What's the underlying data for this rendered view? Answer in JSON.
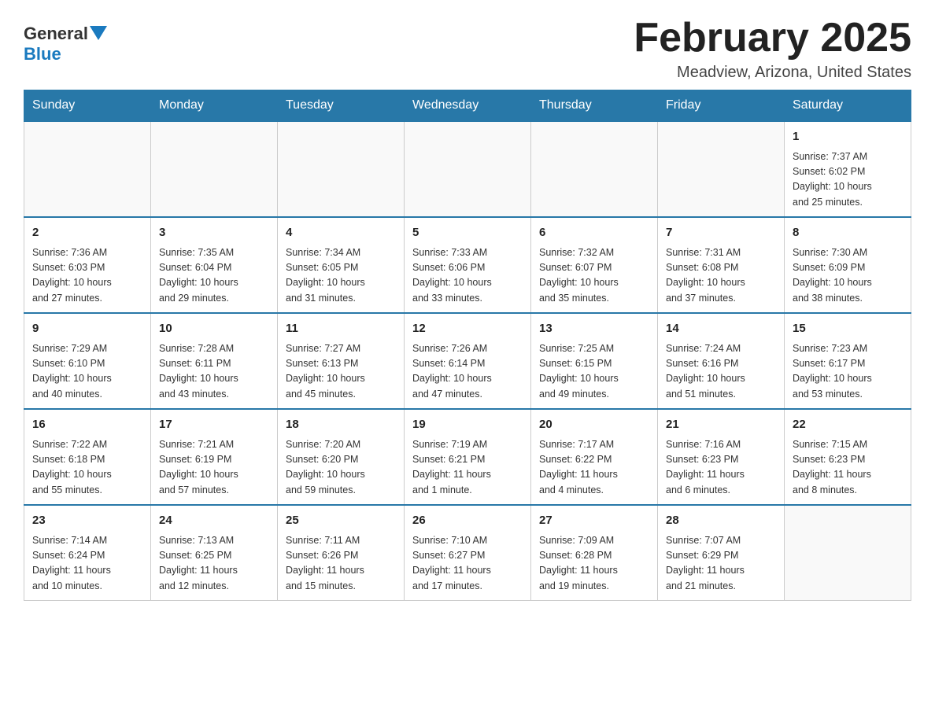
{
  "logo": {
    "general": "General",
    "blue": "Blue",
    "triangle": "▲"
  },
  "header": {
    "title": "February 2025",
    "location": "Meadview, Arizona, United States"
  },
  "days_of_week": [
    "Sunday",
    "Monday",
    "Tuesday",
    "Wednesday",
    "Thursday",
    "Friday",
    "Saturday"
  ],
  "weeks": [
    [
      {
        "day": "",
        "info": ""
      },
      {
        "day": "",
        "info": ""
      },
      {
        "day": "",
        "info": ""
      },
      {
        "day": "",
        "info": ""
      },
      {
        "day": "",
        "info": ""
      },
      {
        "day": "",
        "info": ""
      },
      {
        "day": "1",
        "info": "Sunrise: 7:37 AM\nSunset: 6:02 PM\nDaylight: 10 hours\nand 25 minutes."
      }
    ],
    [
      {
        "day": "2",
        "info": "Sunrise: 7:36 AM\nSunset: 6:03 PM\nDaylight: 10 hours\nand 27 minutes."
      },
      {
        "day": "3",
        "info": "Sunrise: 7:35 AM\nSunset: 6:04 PM\nDaylight: 10 hours\nand 29 minutes."
      },
      {
        "day": "4",
        "info": "Sunrise: 7:34 AM\nSunset: 6:05 PM\nDaylight: 10 hours\nand 31 minutes."
      },
      {
        "day": "5",
        "info": "Sunrise: 7:33 AM\nSunset: 6:06 PM\nDaylight: 10 hours\nand 33 minutes."
      },
      {
        "day": "6",
        "info": "Sunrise: 7:32 AM\nSunset: 6:07 PM\nDaylight: 10 hours\nand 35 minutes."
      },
      {
        "day": "7",
        "info": "Sunrise: 7:31 AM\nSunset: 6:08 PM\nDaylight: 10 hours\nand 37 minutes."
      },
      {
        "day": "8",
        "info": "Sunrise: 7:30 AM\nSunset: 6:09 PM\nDaylight: 10 hours\nand 38 minutes."
      }
    ],
    [
      {
        "day": "9",
        "info": "Sunrise: 7:29 AM\nSunset: 6:10 PM\nDaylight: 10 hours\nand 40 minutes."
      },
      {
        "day": "10",
        "info": "Sunrise: 7:28 AM\nSunset: 6:11 PM\nDaylight: 10 hours\nand 43 minutes."
      },
      {
        "day": "11",
        "info": "Sunrise: 7:27 AM\nSunset: 6:13 PM\nDaylight: 10 hours\nand 45 minutes."
      },
      {
        "day": "12",
        "info": "Sunrise: 7:26 AM\nSunset: 6:14 PM\nDaylight: 10 hours\nand 47 minutes."
      },
      {
        "day": "13",
        "info": "Sunrise: 7:25 AM\nSunset: 6:15 PM\nDaylight: 10 hours\nand 49 minutes."
      },
      {
        "day": "14",
        "info": "Sunrise: 7:24 AM\nSunset: 6:16 PM\nDaylight: 10 hours\nand 51 minutes."
      },
      {
        "day": "15",
        "info": "Sunrise: 7:23 AM\nSunset: 6:17 PM\nDaylight: 10 hours\nand 53 minutes."
      }
    ],
    [
      {
        "day": "16",
        "info": "Sunrise: 7:22 AM\nSunset: 6:18 PM\nDaylight: 10 hours\nand 55 minutes."
      },
      {
        "day": "17",
        "info": "Sunrise: 7:21 AM\nSunset: 6:19 PM\nDaylight: 10 hours\nand 57 minutes."
      },
      {
        "day": "18",
        "info": "Sunrise: 7:20 AM\nSunset: 6:20 PM\nDaylight: 10 hours\nand 59 minutes."
      },
      {
        "day": "19",
        "info": "Sunrise: 7:19 AM\nSunset: 6:21 PM\nDaylight: 11 hours\nand 1 minute."
      },
      {
        "day": "20",
        "info": "Sunrise: 7:17 AM\nSunset: 6:22 PM\nDaylight: 11 hours\nand 4 minutes."
      },
      {
        "day": "21",
        "info": "Sunrise: 7:16 AM\nSunset: 6:23 PM\nDaylight: 11 hours\nand 6 minutes."
      },
      {
        "day": "22",
        "info": "Sunrise: 7:15 AM\nSunset: 6:23 PM\nDaylight: 11 hours\nand 8 minutes."
      }
    ],
    [
      {
        "day": "23",
        "info": "Sunrise: 7:14 AM\nSunset: 6:24 PM\nDaylight: 11 hours\nand 10 minutes."
      },
      {
        "day": "24",
        "info": "Sunrise: 7:13 AM\nSunset: 6:25 PM\nDaylight: 11 hours\nand 12 minutes."
      },
      {
        "day": "25",
        "info": "Sunrise: 7:11 AM\nSunset: 6:26 PM\nDaylight: 11 hours\nand 15 minutes."
      },
      {
        "day": "26",
        "info": "Sunrise: 7:10 AM\nSunset: 6:27 PM\nDaylight: 11 hours\nand 17 minutes."
      },
      {
        "day": "27",
        "info": "Sunrise: 7:09 AM\nSunset: 6:28 PM\nDaylight: 11 hours\nand 19 minutes."
      },
      {
        "day": "28",
        "info": "Sunrise: 7:07 AM\nSunset: 6:29 PM\nDaylight: 11 hours\nand 21 minutes."
      },
      {
        "day": "",
        "info": ""
      }
    ]
  ]
}
